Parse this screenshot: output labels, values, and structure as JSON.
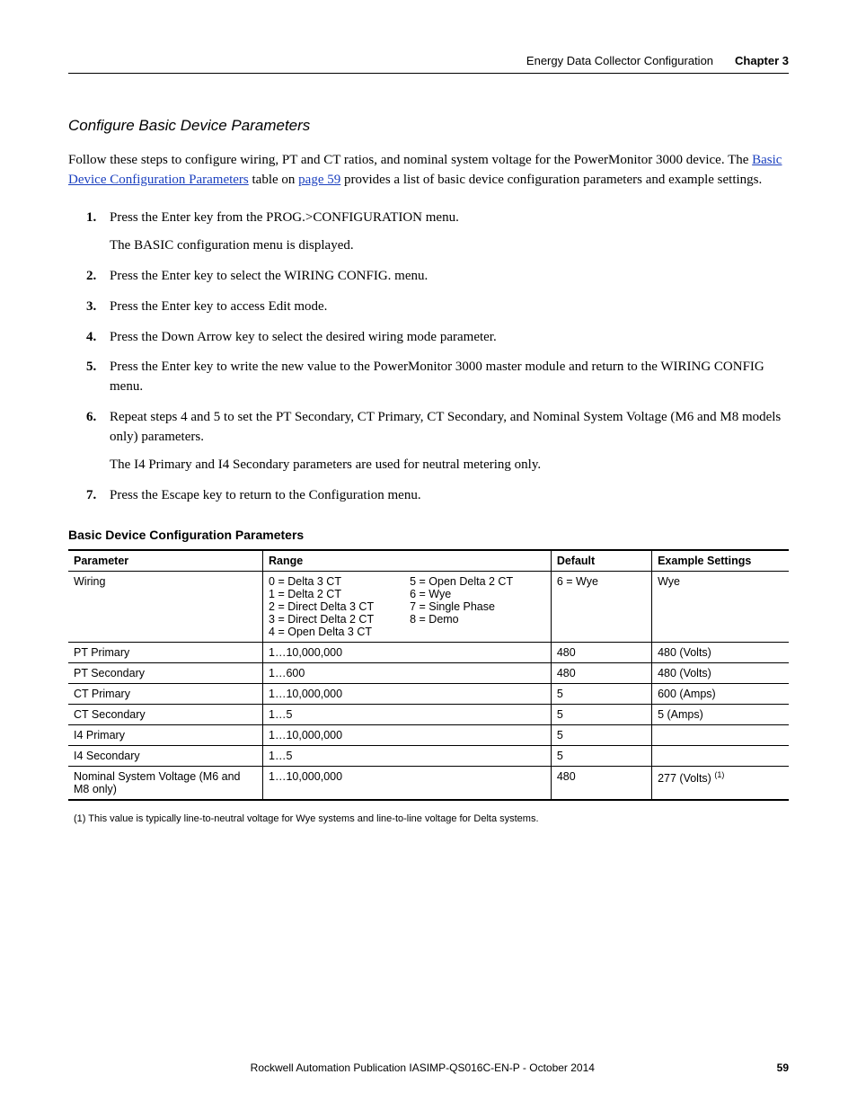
{
  "header": {
    "chapter_title": "Energy Data Collector Configuration",
    "chapter_label": "Chapter 3"
  },
  "section_title": "Configure Basic Device Parameters",
  "intro": {
    "pre_link1": "Follow these steps to configure wiring, PT and CT ratios, and nominal system voltage for the PowerMonitor 3000 device. The ",
    "link1": "Basic Device Configuration Parameters",
    "mid": " table on ",
    "link2": "page 59",
    "post": " provides a list of basic device configuration parameters and example settings."
  },
  "steps": [
    {
      "text": "Press the Enter key from the PROG.>CONFIGURATION menu.",
      "sub": "The BASIC configuration menu is displayed."
    },
    {
      "text": "Press the Enter key to select the WIRING CONFIG. menu."
    },
    {
      "text": "Press the Enter key to access Edit mode."
    },
    {
      "text": "Press the Down Arrow key to select the desired wiring mode parameter."
    },
    {
      "text": "Press the Enter key to write the new value to the PowerMonitor 3000 master module and return to the WIRING CONFIG menu."
    },
    {
      "text": "Repeat steps 4 and 5 to set the PT Secondary, CT Primary, CT Secondary, and Nominal System Voltage (M6 and M8 models only) parameters.",
      "sub": "The I4 Primary and I4 Secondary parameters are used for neutral metering only."
    },
    {
      "text": "Press the Escape key to return to the Configuration menu."
    }
  ],
  "table": {
    "title": "Basic Device Configuration Parameters",
    "headers": {
      "param": "Parameter",
      "range": "Range",
      "default": "Default",
      "example": "Example Settings"
    },
    "wiring": {
      "param": "Wiring",
      "range_left": [
        "0 = Delta 3 CT",
        "1 = Delta 2 CT",
        "2 = Direct Delta 3 CT",
        "3 = Direct Delta 2 CT",
        "4 = Open Delta 3 CT"
      ],
      "range_right": [
        "5 = Open Delta 2 CT",
        "6 = Wye",
        "7 = Single Phase",
        "8 = Demo"
      ],
      "default": "6 = Wye",
      "example": "Wye"
    },
    "rows": [
      {
        "param": "PT Primary",
        "range": "1…10,000,000",
        "default": "480",
        "example": "480 (Volts)"
      },
      {
        "param": "PT Secondary",
        "range": "1…600",
        "default": "480",
        "example": "480 (Volts)"
      },
      {
        "param": "CT Primary",
        "range": "1…10,000,000",
        "default": "5",
        "example": "600 (Amps)"
      },
      {
        "param": "CT Secondary",
        "range": "1…5",
        "default": "5",
        "example": "5 (Amps)"
      },
      {
        "param": "I4 Primary",
        "range": "1…10,000,000",
        "default": "5",
        "example": ""
      },
      {
        "param": "I4 Secondary",
        "range": "1…5",
        "default": "5",
        "example": ""
      }
    ],
    "last_row": {
      "param": "Nominal System Voltage (M6 and M8 only)",
      "range": "1…10,000,000",
      "default": "480",
      "example_prefix": "277 (Volts)",
      "example_note": "(1)"
    }
  },
  "footnote": "(1)   This value is typically line-to-neutral voltage for Wye systems and line-to-line voltage for Delta systems.",
  "footer": {
    "publication": "Rockwell Automation Publication IASIMP-QS016C-EN-P - October 2014",
    "page": "59"
  }
}
